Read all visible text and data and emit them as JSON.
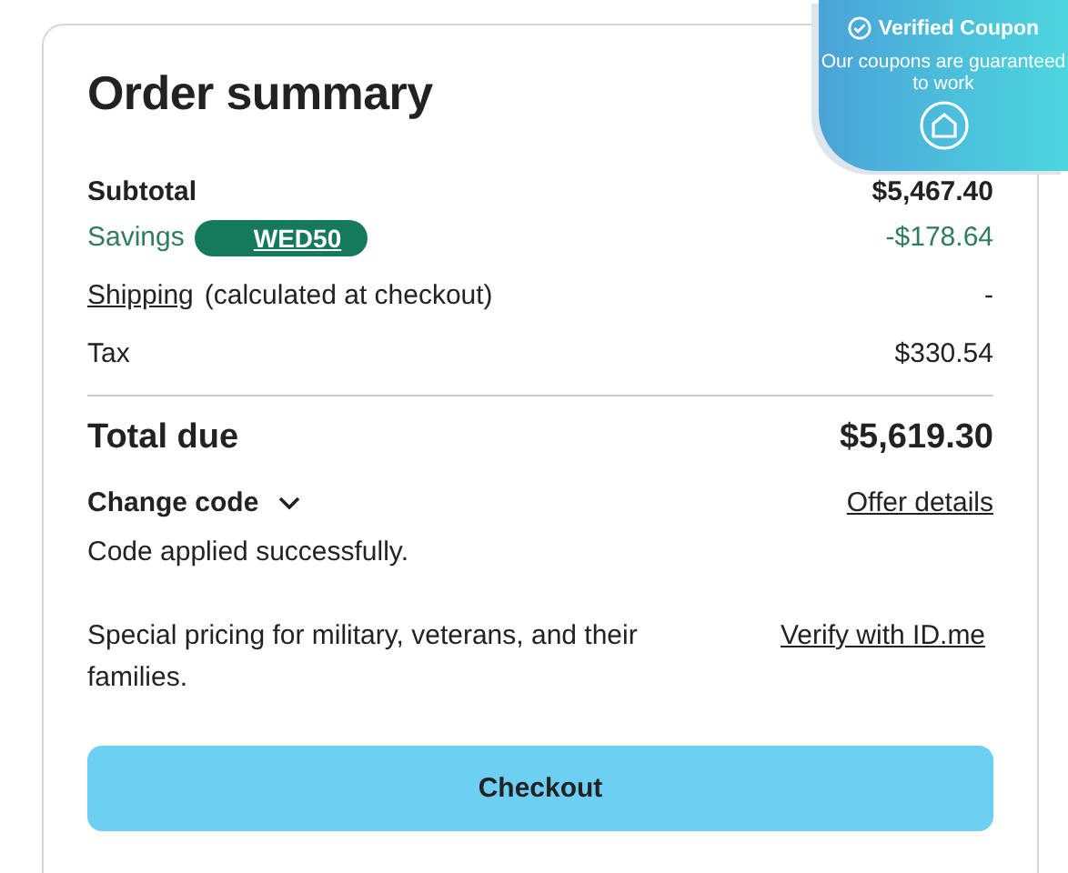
{
  "title": "Order summary",
  "lines": [
    {
      "kind": "subtotal",
      "label": "Subtotal",
      "value": "$5,467.40"
    },
    {
      "kind": "savings",
      "label": "Savings",
      "code": "WED50",
      "value": "-$178.64"
    },
    {
      "kind": "shipping",
      "link": "Shipping",
      "label": "(calculated at checkout)",
      "value": "-"
    },
    {
      "kind": "tax",
      "label": "Tax",
      "value": "$330.54"
    }
  ],
  "total": {
    "label": "Total due",
    "value": "$5,619.30"
  },
  "change_code": {
    "label": "Change code",
    "expanded": false
  },
  "offer_details": "Offer details",
  "message": "Code applied successfully.",
  "military": {
    "text": "Special pricing for military, veterans, and their families.",
    "link": "Verify with ID.me"
  },
  "checkout": "Checkout",
  "badge": {
    "title": "Verified Coupon",
    "text": "Our coupons are guaranteed to work"
  }
}
